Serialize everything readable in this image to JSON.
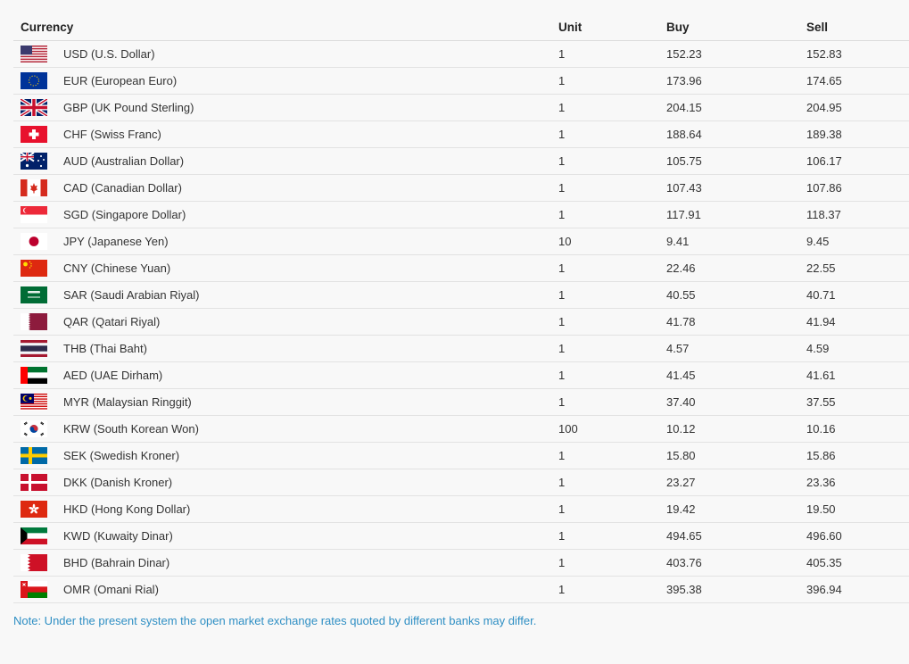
{
  "table": {
    "headers": {
      "currency": "Currency",
      "unit": "Unit",
      "buy": "Buy",
      "sell": "Sell"
    },
    "rows": [
      {
        "flag": "us-flag-icon",
        "currency": "USD (U.S. Dollar)",
        "unit": "1",
        "buy": "152.23",
        "sell": "152.83"
      },
      {
        "flag": "eu-flag-icon",
        "currency": "EUR (European Euro)",
        "unit": "1",
        "buy": "173.96",
        "sell": "174.65"
      },
      {
        "flag": "gb-flag-icon",
        "currency": "GBP (UK Pound Sterling)",
        "unit": "1",
        "buy": "204.15",
        "sell": "204.95"
      },
      {
        "flag": "ch-flag-icon",
        "currency": "CHF (Swiss Franc)",
        "unit": "1",
        "buy": "188.64",
        "sell": "189.38"
      },
      {
        "flag": "au-flag-icon",
        "currency": "AUD (Australian Dollar)",
        "unit": "1",
        "buy": "105.75",
        "sell": "106.17"
      },
      {
        "flag": "ca-flag-icon",
        "currency": "CAD (Canadian Dollar)",
        "unit": "1",
        "buy": "107.43",
        "sell": "107.86"
      },
      {
        "flag": "sg-flag-icon",
        "currency": "SGD (Singapore Dollar)",
        "unit": "1",
        "buy": "117.91",
        "sell": "118.37"
      },
      {
        "flag": "jp-flag-icon",
        "currency": "JPY (Japanese Yen)",
        "unit": "10",
        "buy": "9.41",
        "sell": "9.45"
      },
      {
        "flag": "cn-flag-icon",
        "currency": "CNY (Chinese Yuan)",
        "unit": "1",
        "buy": "22.46",
        "sell": "22.55"
      },
      {
        "flag": "sa-flag-icon",
        "currency": "SAR (Saudi Arabian Riyal)",
        "unit": "1",
        "buy": "40.55",
        "sell": "40.71"
      },
      {
        "flag": "qa-flag-icon",
        "currency": "QAR (Qatari Riyal)",
        "unit": "1",
        "buy": "41.78",
        "sell": "41.94"
      },
      {
        "flag": "th-flag-icon",
        "currency": "THB (Thai Baht)",
        "unit": "1",
        "buy": "4.57",
        "sell": "4.59"
      },
      {
        "flag": "ae-flag-icon",
        "currency": "AED (UAE Dirham)",
        "unit": "1",
        "buy": "41.45",
        "sell": "41.61"
      },
      {
        "flag": "my-flag-icon",
        "currency": "MYR (Malaysian Ringgit)",
        "unit": "1",
        "buy": "37.40",
        "sell": "37.55"
      },
      {
        "flag": "kr-flag-icon",
        "currency": "KRW (South Korean Won)",
        "unit": "100",
        "buy": "10.12",
        "sell": "10.16"
      },
      {
        "flag": "se-flag-icon",
        "currency": "SEK (Swedish Kroner)",
        "unit": "1",
        "buy": "15.80",
        "sell": "15.86"
      },
      {
        "flag": "dk-flag-icon",
        "currency": "DKK (Danish Kroner)",
        "unit": "1",
        "buy": "23.27",
        "sell": "23.36"
      },
      {
        "flag": "hk-flag-icon",
        "currency": "HKD (Hong Kong Dollar)",
        "unit": "1",
        "buy": "19.42",
        "sell": "19.50"
      },
      {
        "flag": "kw-flag-icon",
        "currency": "KWD (Kuwaity Dinar)",
        "unit": "1",
        "buy": "494.65",
        "sell": "496.60"
      },
      {
        "flag": "bh-flag-icon",
        "currency": "BHD (Bahrain Dinar)",
        "unit": "1",
        "buy": "403.76",
        "sell": "405.35"
      },
      {
        "flag": "om-flag-icon",
        "currency": "OMR (Omani Rial)",
        "unit": "1",
        "buy": "395.38",
        "sell": "396.94"
      }
    ]
  },
  "note": "Note: Under the present system the open market exchange rates quoted by different banks may differ."
}
